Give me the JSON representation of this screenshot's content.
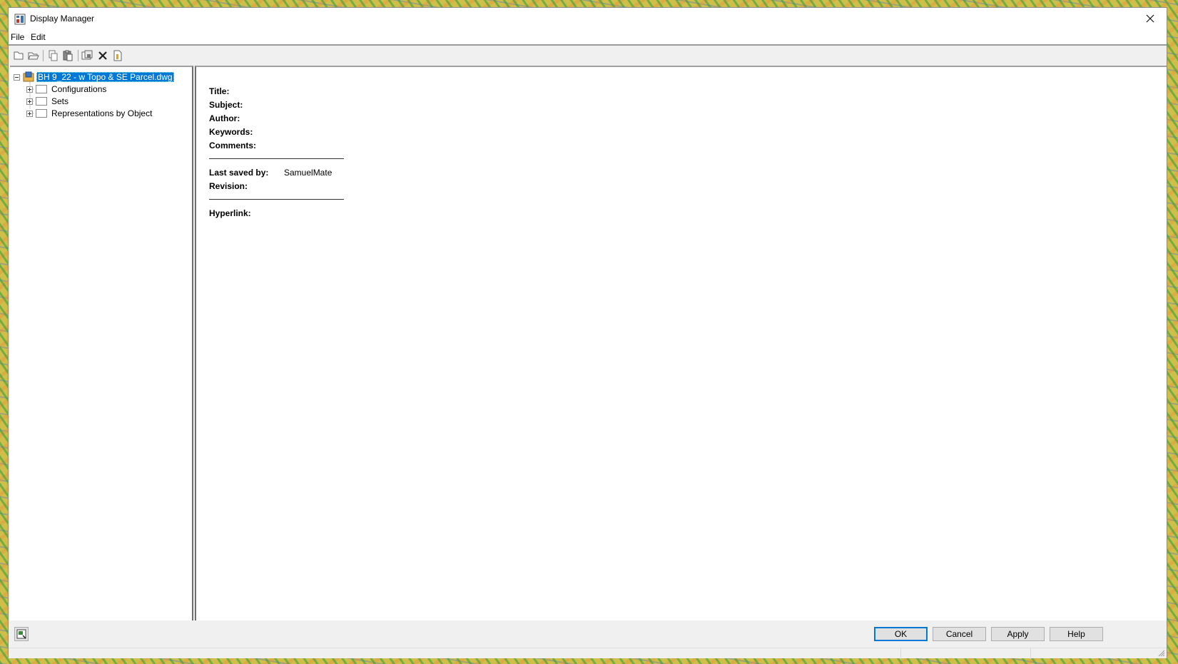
{
  "window": {
    "title": "Display Manager"
  },
  "menu": {
    "file": "File",
    "edit": "Edit"
  },
  "toolbar": {
    "icons": [
      "new-icon",
      "open-icon",
      "copy-icon",
      "paste-icon",
      "purge-icon",
      "delete-icon",
      "properties-icon"
    ]
  },
  "tree": {
    "root": "BH 9_22 - w Topo & SE Parcel.dwg",
    "children": [
      {
        "label": "Configurations"
      },
      {
        "label": "Sets"
      },
      {
        "label": "Representations by Object"
      }
    ]
  },
  "properties": {
    "title_label": "Title:",
    "subject_label": "Subject:",
    "author_label": "Author:",
    "keywords_label": "Keywords:",
    "comments_label": "Comments:",
    "last_saved_label": "Last saved by:",
    "last_saved_value": "SamuelMate",
    "revision_label": "Revision:",
    "hyperlink_label": "Hyperlink:"
  },
  "buttons": {
    "ok": "OK",
    "cancel": "Cancel",
    "apply": "Apply",
    "help": "Help"
  },
  "colors": {
    "selection": "#0078d7",
    "default_button_border": "#0078d7"
  }
}
